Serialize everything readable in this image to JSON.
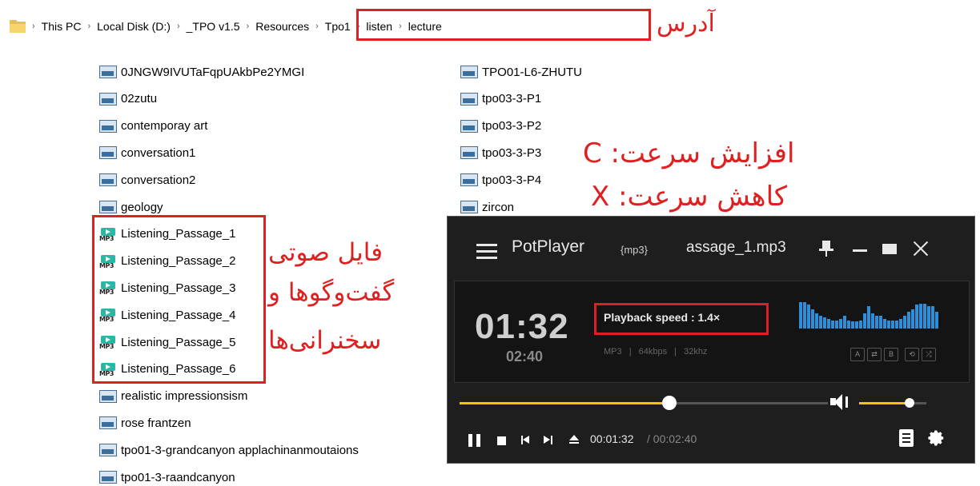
{
  "breadcrumb": [
    "This PC",
    "Local Disk (D:)",
    "_TPO v1.5",
    "Resources",
    "Tpo1",
    "listen",
    "lecture"
  ],
  "annotations": {
    "address": "آدرس",
    "speed_up": "افزایش سرعت: C",
    "speed_down": "کاهش سرعت: X",
    "audio_files_1": "فایل صوتی",
    "audio_files_2": "گفت‌وگوها و",
    "audio_files_3": "سخنرانی‌ها"
  },
  "files_left": [
    {
      "name": "0JNGW9IVUTaFqpUAkbPe2YMGI",
      "type": "image"
    },
    {
      "name": "02zutu",
      "type": "image"
    },
    {
      "name": "contemporay art",
      "type": "image"
    },
    {
      "name": "conversation1",
      "type": "image"
    },
    {
      "name": "conversation2",
      "type": "image"
    },
    {
      "name": "geology",
      "type": "image"
    },
    {
      "name": "Listening_Passage_1",
      "type": "mp3"
    },
    {
      "name": "Listening_Passage_2",
      "type": "mp3"
    },
    {
      "name": "Listening_Passage_3",
      "type": "mp3"
    },
    {
      "name": "Listening_Passage_4",
      "type": "mp3"
    },
    {
      "name": "Listening_Passage_5",
      "type": "mp3"
    },
    {
      "name": "Listening_Passage_6",
      "type": "mp3"
    },
    {
      "name": "realistic impressionsism",
      "type": "image"
    },
    {
      "name": "rose frantzen",
      "type": "image"
    },
    {
      "name": "tpo01-3-grandcanyon applachinanmoutaions",
      "type": "image"
    },
    {
      "name": "tpo01-3-raandcanyon",
      "type": "image"
    }
  ],
  "files_right": [
    {
      "name": "TPO01-L6-ZHUTU",
      "type": "image"
    },
    {
      "name": "tpo03-3-P1",
      "type": "image"
    },
    {
      "name": "tpo03-3-P2",
      "type": "image"
    },
    {
      "name": "tpo03-3-P3",
      "type": "image"
    },
    {
      "name": "tpo03-3-P4",
      "type": "image"
    },
    {
      "name": "zircon",
      "type": "image"
    }
  ],
  "mp3_icon_label": "MP3",
  "player": {
    "app_name": "PotPlayer",
    "format": "{mp3}",
    "filename": "assage_1.mp3",
    "time": "01:32",
    "duration": "02:40",
    "speed": "Playback speed : 1.4×",
    "meta": [
      "MP3",
      "|",
      "64kbps",
      "|",
      "32khz"
    ],
    "buttons_ab": [
      "A",
      "⇄",
      "B",
      "⟲",
      "⤮"
    ],
    "progress_fraction": 0.57,
    "volume_fraction": 0.75,
    "elapsed": "00:01:32",
    "separator": "/",
    "total": "00:02:40",
    "accent": "#f0c800",
    "viz_color": "#2d8fd9"
  },
  "colors": {
    "annotation": "#e02020",
    "folder": "#f7d56d"
  }
}
